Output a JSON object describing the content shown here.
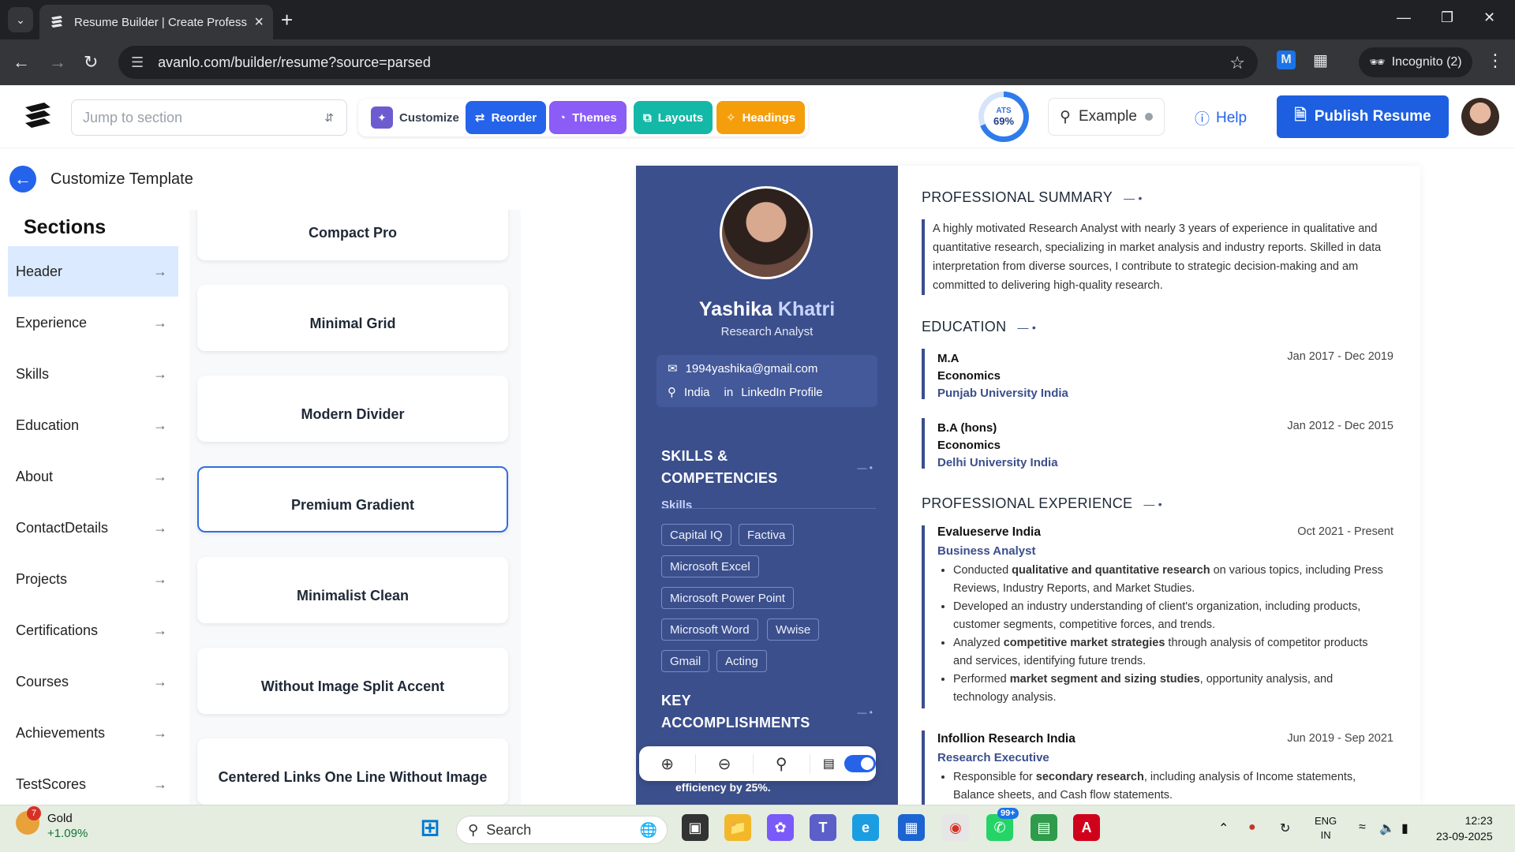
{
  "browser": {
    "tab_title": "Resume Builder | Create Profess",
    "url": "avanlo.com/builder/resume?source=parsed",
    "incognito_label": "Incognito (2)"
  },
  "toolbar": {
    "jump_placeholder": "Jump to section",
    "tools": [
      {
        "label": "Customize",
        "color": "#ffffff"
      },
      {
        "label": "Reorder",
        "color": "#2563eb"
      },
      {
        "label": "Themes",
        "color": "#8b5cf6"
      },
      {
        "label": "Layouts",
        "color": "#14b8a6"
      },
      {
        "label": "Headings",
        "color": "#f59e0b"
      }
    ],
    "ats_label": "ATS",
    "ats_score": "69%",
    "ats_fraction": 0.69,
    "example_label": "Example",
    "help_label": "Help",
    "publish_label": "Publish Resume"
  },
  "panel": {
    "title": "Customize Template",
    "sections_heading": "Sections",
    "sections": [
      "Header",
      "Experience",
      "Skills",
      "Education",
      "About",
      "ContactDetails",
      "Projects",
      "Certifications",
      "Courses",
      "Achievements",
      "TestScores"
    ],
    "active_section": "Header",
    "templates": [
      "Compact Pro",
      "Minimal Grid",
      "Modern Divider",
      "Premium Gradient",
      "Minimalist Clean",
      "Without Image Split Accent",
      "Centered Links One Line Without Image"
    ],
    "selected_template": "Premium Gradient"
  },
  "resume": {
    "first_name": "Yashika",
    "last_name": "Khatri",
    "role": "Research Analyst",
    "email": "1994yashika@gmail.com",
    "location": "India",
    "linkedin": "LinkedIn Profile",
    "skills_heading_1": "SKILLS &",
    "skills_heading_2": "COMPETENCIES",
    "skills_label": "Skills",
    "skills": [
      "Capital IQ",
      "Factiva",
      "Microsoft Excel",
      "Microsoft Power Point",
      "Microsoft Word",
      "Wwise",
      "Gmail",
      "Acting"
    ],
    "accomplishments_heading_1": "KEY",
    "accomplishments_heading_2": "ACCOMPLISHMENTS",
    "accomplishment_snippet": "efficiency by 25%.",
    "summary_heading": "PROFESSIONAL SUMMARY",
    "summary": "A highly motivated Research Analyst with nearly 3 years of experience in qualitative and quantitative research, specializing in market analysis and industry reports. Skilled in data interpretation from diverse sources, I contribute to strategic decision-making and am committed to delivering high-quality research.",
    "education_heading": "EDUCATION",
    "education": [
      {
        "degree": "M.A",
        "field": "Economics",
        "school": "Punjab University India",
        "dates": "Jan 2017 - Dec 2019"
      },
      {
        "degree": "B.A (hons)",
        "field": "Economics",
        "school": "Delhi University India",
        "dates": "Jan 2012 - Dec 2015"
      }
    ],
    "experience_heading": "PROFESSIONAL EXPERIENCE",
    "experience": [
      {
        "company": "Evalueserve India",
        "title": "Business Analyst",
        "dates": "Oct 2021 - Present",
        "bullets": [
          {
            "pre": "Conducted ",
            "bold": "qualitative and quantitative research",
            "post": " on various topics, including Press Reviews, Industry Reports, and Market Studies."
          },
          {
            "pre": "Developed an industry understanding of client's organization, including products, customer segments, competitive forces, and trends.",
            "bold": "",
            "post": ""
          },
          {
            "pre": "Analyzed ",
            "bold": "competitive market strategies",
            "post": " through analysis of competitor products and services, identifying future trends."
          },
          {
            "pre": "Performed ",
            "bold": "market segment and sizing studies",
            "post": ", opportunity analysis, and technology analysis."
          }
        ]
      },
      {
        "company": "Infollion Research India",
        "title": "Research Executive",
        "dates": "Jun 2019 - Sep 2021",
        "bullets": [
          {
            "pre": "Responsible for ",
            "bold": "secondary research",
            "post": ", including analysis of Income statements, Balance sheets, and Cash flow statements."
          }
        ]
      }
    ]
  },
  "taskbar": {
    "stock_name": "Gold",
    "stock_change": "+1.09%",
    "stock_badge": "7",
    "search_label": "Search",
    "whatsapp_badge": "99+",
    "lang_1": "ENG",
    "lang_2": "IN",
    "time": "12:23",
    "date": "23-09-2025"
  }
}
